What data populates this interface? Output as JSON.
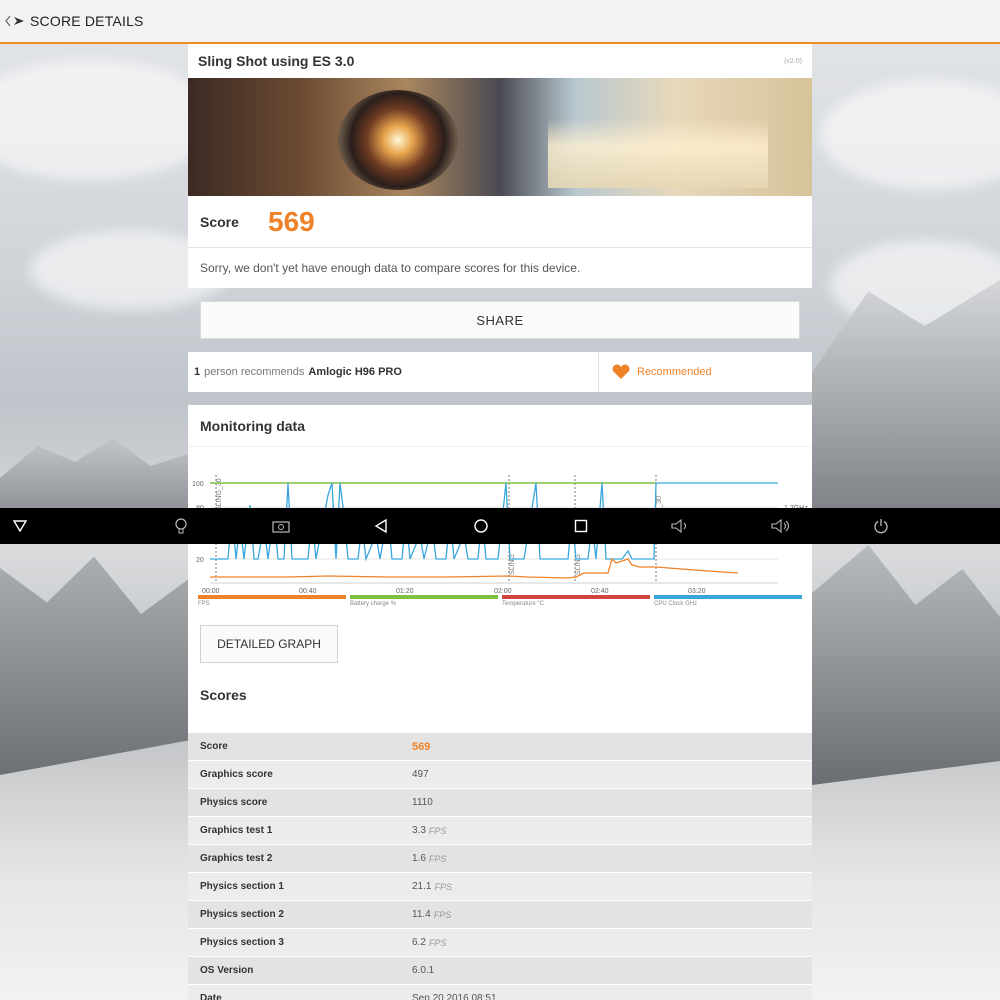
{
  "topbar": {
    "title": "SCORE DETAILS"
  },
  "test": {
    "name": "Sling Shot using ES 3.0",
    "version": "(v2.0)",
    "score_label": "Score",
    "score_value": "569",
    "note": "Sorry, we don't yet have enough data to compare scores for this device."
  },
  "share": {
    "label": "SHARE"
  },
  "recommend": {
    "count": "1",
    "text": "person recommends",
    "device": "Amlogic H96 PRO",
    "button": "Recommended"
  },
  "monitoring": {
    "title": "Monitoring data",
    "detailed_label": "DETAILED GRAPH",
    "y_ticks": [
      "100",
      "80",
      "20"
    ],
    "x_ticks": [
      "00:00",
      "00:40",
      "01:20",
      "02:00",
      "02:40",
      "03:20"
    ],
    "freq_label": "1.2GHz",
    "markers": [
      "SLING_30",
      "SLING",
      "SLING",
      "ES_30"
    ],
    "legend": [
      {
        "label": "FPS",
        "color": "#ef8228"
      },
      {
        "label": "Battery charge %",
        "color": "#7dc043"
      },
      {
        "label": "Temperature °C",
        "color": "#d0443f"
      },
      {
        "label": "CPU Clock GHz",
        "color": "#3aa6dd"
      }
    ]
  },
  "scores": {
    "title": "Scores",
    "rows": [
      {
        "k": "Score",
        "v": "569",
        "u": ""
      },
      {
        "k": "Graphics score",
        "v": "497",
        "u": ""
      },
      {
        "k": "Physics score",
        "v": "1110",
        "u": ""
      },
      {
        "k": "Graphics test 1",
        "v": "3.3",
        "u": "FPS"
      },
      {
        "k": "Graphics test 2",
        "v": "1.6",
        "u": "FPS"
      },
      {
        "k": "Physics section 1",
        "v": "21.1",
        "u": "FPS"
      },
      {
        "k": "Physics section 2",
        "v": "11.4",
        "u": "FPS"
      },
      {
        "k": "Physics section 3",
        "v": "6.2",
        "u": "FPS"
      },
      {
        "k": "OS Version",
        "v": "6.0.1",
        "u": ""
      },
      {
        "k": "Date",
        "v": "Sep 20 2016 08:51",
        "u": ""
      }
    ]
  },
  "navbar": {
    "icons": [
      "hide-bar-icon",
      "lightbulb-icon",
      "screenshot-icon",
      "back-icon",
      "home-icon",
      "recents-icon",
      "volume-down-icon",
      "volume-up-icon",
      "power-icon"
    ]
  }
}
